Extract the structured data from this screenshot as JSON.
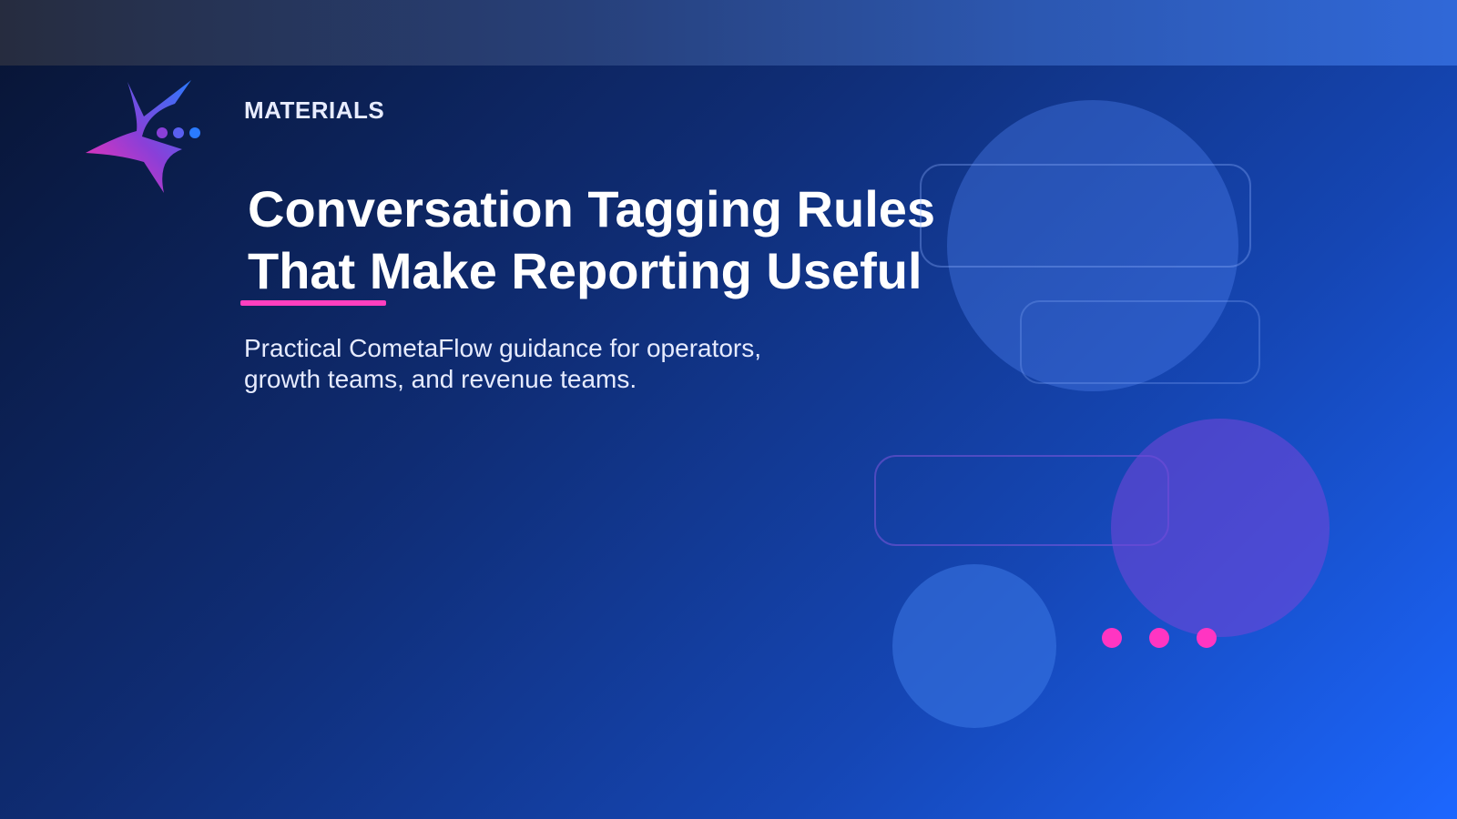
{
  "header": {
    "eyebrow": "MATERIALS"
  },
  "main": {
    "title_line_1": "Conversation Tagging Rules",
    "title_line_2": "That Make Reporting Useful",
    "subtitle_line_1": "Practical CometaFlow guidance for operators,",
    "subtitle_line_2": "growth teams, and revenue teams."
  },
  "logo": {
    "icon": "comet-star-chat-icon"
  },
  "colors": {
    "accent": "#ff3fbf",
    "background_start": "#081433",
    "background_end": "#1c67ff",
    "text": "#ffffff"
  }
}
